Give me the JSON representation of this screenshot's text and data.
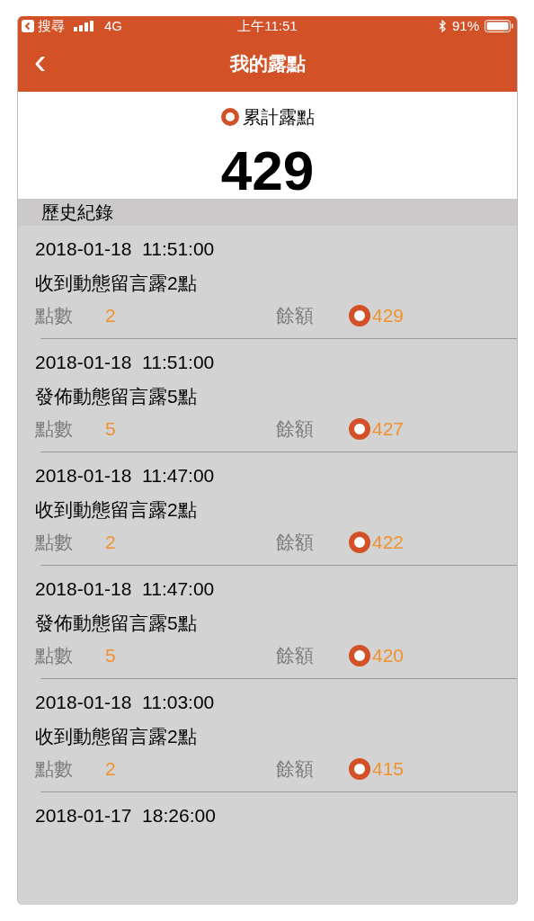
{
  "status_bar": {
    "back_app": "搜尋",
    "network": "4G",
    "time": "上午11:51",
    "battery": "91%"
  },
  "nav": {
    "back": "‹",
    "title": "我的露點"
  },
  "summary": {
    "label": "累計露點",
    "total": "429"
  },
  "history": {
    "title": "歷史紀錄",
    "records": [
      {
        "datetime": "2018-01-18  11:51:00",
        "description": "收到動態留言露2點",
        "points_label": "點數",
        "points": "2",
        "balance_label": "餘額",
        "balance": "429"
      },
      {
        "datetime": "2018-01-18  11:51:00",
        "description": "發佈動態留言露5點",
        "points_label": "點數",
        "points": "5",
        "balance_label": "餘額",
        "balance": "427"
      },
      {
        "datetime": "2018-01-18  11:47:00",
        "description": "收到動態留言露2點",
        "points_label": "點數",
        "points": "2",
        "balance_label": "餘額",
        "balance": "422"
      },
      {
        "datetime": "2018-01-18  11:47:00",
        "description": "發佈動態留言露5點",
        "points_label": "點數",
        "points": "5",
        "balance_label": "餘額",
        "balance": "420"
      },
      {
        "datetime": "2018-01-18  11:03:00",
        "description": "收到動態留言露2點",
        "points_label": "點數",
        "points": "2",
        "balance_label": "餘額",
        "balance": "415"
      },
      {
        "datetime": "2018-01-17  18:26:00"
      }
    ]
  }
}
